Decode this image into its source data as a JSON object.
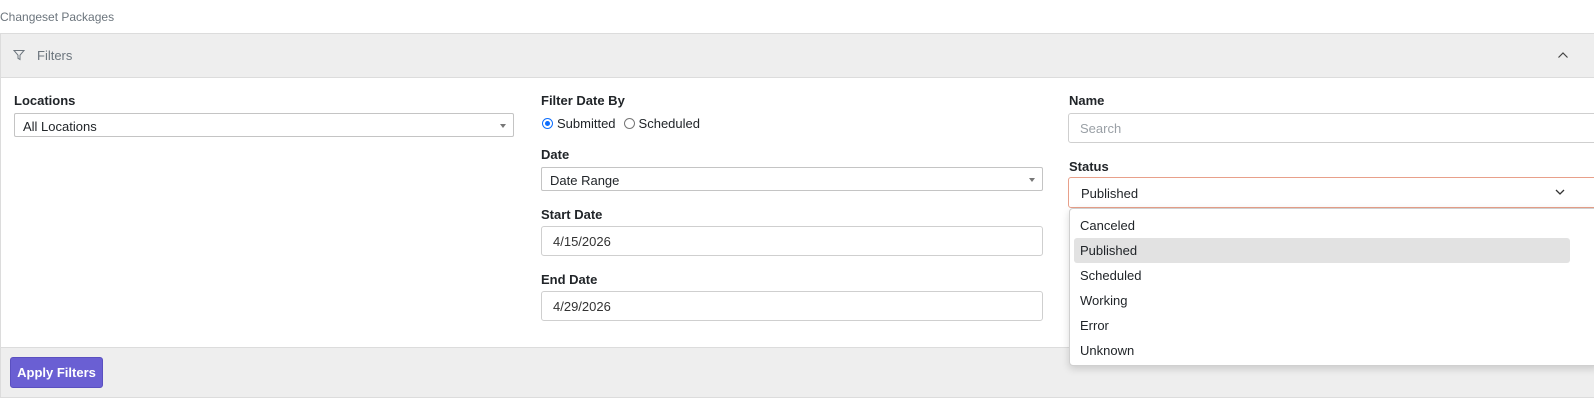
{
  "page": {
    "title": "Changeset Packages"
  },
  "filters_panel": {
    "title": "Filters"
  },
  "locations": {
    "label": "Locations",
    "value": "All Locations"
  },
  "filter_date_by": {
    "label": "Filter Date By",
    "options": [
      {
        "label": "Submitted",
        "checked": true
      },
      {
        "label": "Scheduled",
        "checked": false
      }
    ]
  },
  "date": {
    "label": "Date",
    "value": "Date Range"
  },
  "start_date": {
    "label": "Start Date",
    "value": "4/15/2026"
  },
  "end_date": {
    "label": "End Date",
    "value": "4/29/2026"
  },
  "name": {
    "label": "Name",
    "placeholder": "Search"
  },
  "status": {
    "label": "Status",
    "value": "Published",
    "options": [
      "Canceled",
      "Published",
      "Scheduled",
      "Working",
      "Error",
      "Unknown"
    ],
    "selected_index": 1
  },
  "footer": {
    "apply_label": "Apply Filters"
  },
  "colors": {
    "accent": "#6a5fd3",
    "header_bg": "#eeeeee",
    "radio_checked": "#0d6efd",
    "status_border": "#e8a08a",
    "dropdown_selected_bg": "#e2e2e2"
  },
  "icons": {
    "filter": "filter-icon",
    "collapse": "chevron-up-icon",
    "dropdown": "chevron-down-icon"
  }
}
